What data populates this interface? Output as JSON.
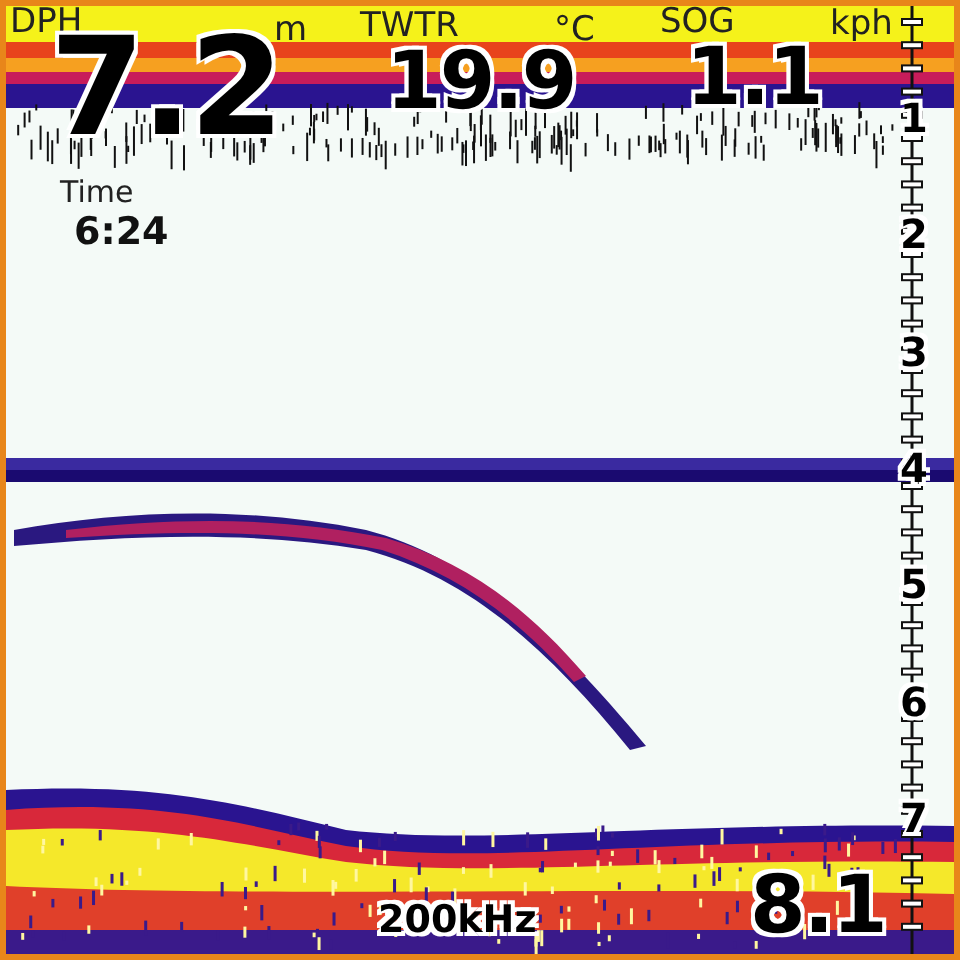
{
  "readouts": [
    {
      "label": "DPH",
      "value": "7.2",
      "unit": "m",
      "kind": "large"
    },
    {
      "label": "TWTR",
      "value": "19.9",
      "unit": "°C",
      "kind": "medium"
    },
    {
      "label": "SOG",
      "value": "1.1",
      "unit": "kph",
      "kind": "medium"
    }
  ],
  "time": {
    "label": "Time",
    "value": "6:24"
  },
  "depth_scale": [
    "1",
    "2",
    "3",
    "4",
    "5",
    "6",
    "7"
  ],
  "frequency": "200kHz",
  "bottom_depth": "8.1"
}
